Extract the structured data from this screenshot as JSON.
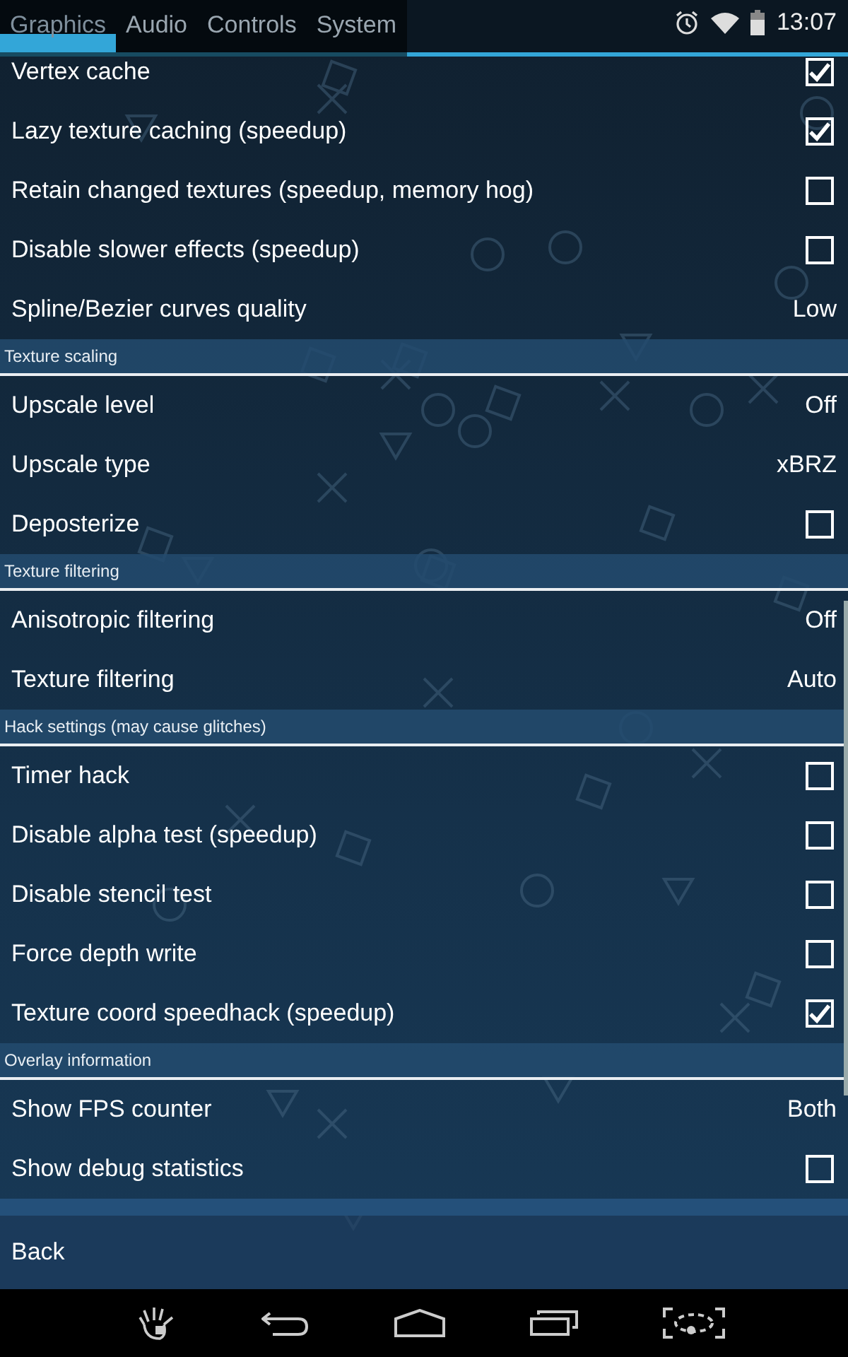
{
  "tabs": [
    {
      "label": "Graphics",
      "selected": true
    },
    {
      "label": "Audio",
      "selected": false
    },
    {
      "label": "Controls",
      "selected": false
    },
    {
      "label": "System",
      "selected": false
    }
  ],
  "status_bar": {
    "time": "13:07"
  },
  "sections": [
    {
      "items": [
        {
          "label": "Vertex cache",
          "kind": "checkbox",
          "checked": true
        },
        {
          "label": "Lazy texture caching (speedup)",
          "kind": "checkbox",
          "checked": true
        },
        {
          "label": "Retain changed textures (speedup, memory hog)",
          "kind": "checkbox",
          "checked": false
        },
        {
          "label": "Disable slower effects (speedup)",
          "kind": "checkbox",
          "checked": false
        },
        {
          "label": "Spline/Bezier curves quality",
          "kind": "value",
          "value": "Low"
        }
      ]
    },
    {
      "title": "Texture scaling",
      "items": [
        {
          "label": "Upscale level",
          "kind": "value",
          "value": "Off"
        },
        {
          "label": "Upscale type",
          "kind": "value",
          "value": "xBRZ"
        },
        {
          "label": "Deposterize",
          "kind": "checkbox",
          "checked": false
        }
      ]
    },
    {
      "title": "Texture filtering",
      "items": [
        {
          "label": "Anisotropic filtering",
          "kind": "value",
          "value": "Off"
        },
        {
          "label": "Texture filtering",
          "kind": "value",
          "value": "Auto"
        }
      ]
    },
    {
      "title": "Hack settings (may cause glitches)",
      "items": [
        {
          "label": "Timer hack",
          "kind": "checkbox",
          "checked": false
        },
        {
          "label": "Disable alpha test (speedup)",
          "kind": "checkbox",
          "checked": false
        },
        {
          "label": "Disable stencil test",
          "kind": "checkbox",
          "checked": false
        },
        {
          "label": "Force depth write",
          "kind": "checkbox",
          "checked": false
        },
        {
          "label": "Texture coord speedhack (speedup)",
          "kind": "checkbox",
          "checked": true
        }
      ]
    },
    {
      "title": "Overlay information",
      "items": [
        {
          "label": "Show FPS counter",
          "kind": "value",
          "value": "Both"
        },
        {
          "label": "Show debug statistics",
          "kind": "checkbox",
          "checked": false
        }
      ]
    }
  ],
  "back_button": "Back"
}
